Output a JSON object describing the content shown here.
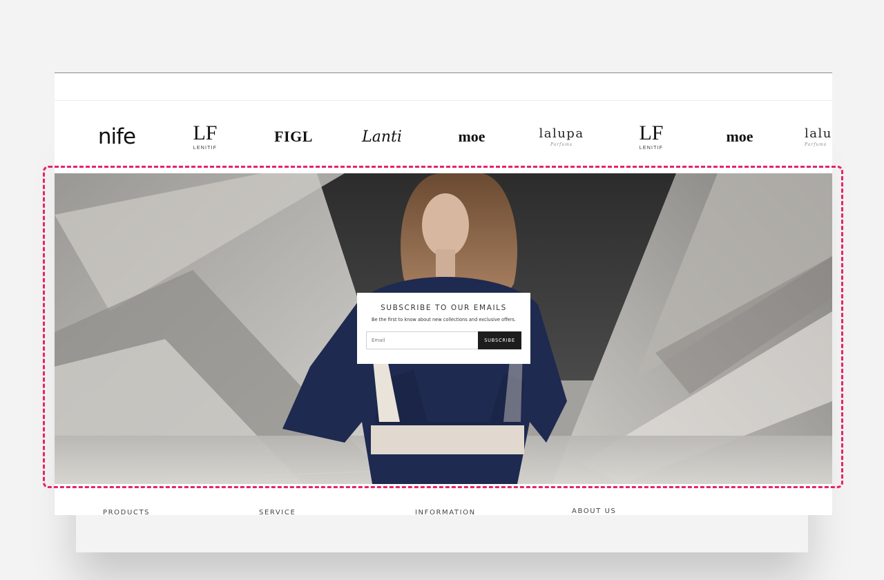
{
  "brand_logos": [
    "nife",
    "LF",
    "LENITIF",
    "FIGL",
    "Lanti",
    "moe",
    "lalupa",
    "Parfums",
    "LF",
    "LENITIF",
    "moe",
    "lalu",
    "Parfums"
  ],
  "newsletter": {
    "title": "SUBSCRIBE TO OUR EMAILS",
    "subtitle": "Be the first to know about new collections and exclusive offers.",
    "email_placeholder": "Email",
    "subscribe_label": "SUBSCRIBE"
  },
  "footer": {
    "columns": [
      "PRODUCTS",
      "SERVICE",
      "INFORMATION",
      "ABOUT US"
    ]
  },
  "colors": {
    "highlight": "#e5236b",
    "button_bg": "#1d1d1d",
    "background": "#f3f3f3"
  }
}
